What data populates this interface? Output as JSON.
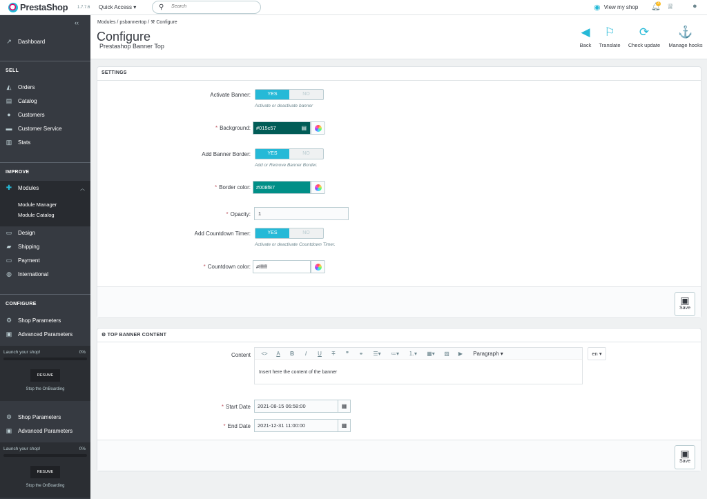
{
  "topbar": {
    "brand": "PrestaShop",
    "version": "1.7.7.6",
    "quick_access": "Quick Access ▾",
    "search_placeholder": "Search",
    "view_shop": "View my shop",
    "notif_count": "3"
  },
  "sidebar": {
    "dashboard": "Dashboard",
    "sell_heading": "SELL",
    "sell_items": [
      "Orders",
      "Catalog",
      "Customers",
      "Customer Service",
      "Stats"
    ],
    "improve_heading": "IMPROVE",
    "modules": "Modules",
    "module_sub": [
      "Module Manager",
      "Module Catalog"
    ],
    "improve_items": [
      "Design",
      "Shipping",
      "Payment",
      "International"
    ],
    "configure_heading": "CONFIGURE",
    "configure_items": [
      "Shop Parameters",
      "Advanced Parameters"
    ],
    "onboarding": {
      "label": "Launch your shop!",
      "percent": "0%",
      "resume": "RESUME",
      "stop": "Stop the OnBoarding"
    },
    "configure_items_2": [
      "Shop Parameters",
      "Advanced Parameters"
    ],
    "onboarding_2": {
      "label": "Launch your shop!",
      "percent": "0%",
      "resume": "RESUME",
      "stop": "Stop the OnBoarding"
    }
  },
  "header": {
    "breadcrumb": [
      "Modules",
      "psbannertop",
      "Configure"
    ],
    "title": "Configure",
    "subtitle": "Prestashop Banner Top",
    "toolbar": [
      "Back",
      "Translate",
      "Check update",
      "Manage hooks"
    ]
  },
  "settings": {
    "heading": "SETTINGS",
    "activate_label": "Activate Banner:",
    "activate_help": "Activate or deactivate banner",
    "background_label": "Background:",
    "background_value": "#015c57",
    "border_label": "Add Banner Border:",
    "border_help": "Add or Remove Banner Border.",
    "border_color_label": "Border color:",
    "border_color_value": "#008f87",
    "opacity_label": "Opacity:",
    "opacity_value": "1",
    "countdown_label": "Add Countdown Timer:",
    "countdown_help": "Activate or deactivate Countdown Timer.",
    "countdown_color_label": "Countdown color:",
    "countdown_color_value": "#ffffff",
    "yes": "YES",
    "no": "NO",
    "save": "Save",
    "accent": "#25b9d7"
  },
  "content": {
    "heading": "TOP BANNER CONTENT",
    "content_label": "Content",
    "paragraph": "Paragraph",
    "editor_text": "Insert here the content of the banner",
    "lang": "en ▾",
    "start_label": "Start Date",
    "start_value": "2021-08-15 06:58:00",
    "end_label": "End Date",
    "end_value": "2021-12-31 11:00:00",
    "save": "Save"
  }
}
